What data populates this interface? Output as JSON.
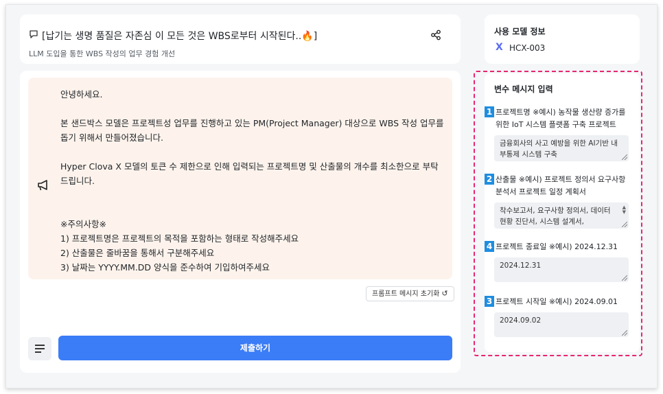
{
  "header": {
    "title": "[납기는 생명 품질은 자존심 이 모든 것은 WBS로부터 시작된다..🔥]",
    "subtitle": "LLM 도입을 통한 WBS 작성의 업무 경험 개선",
    "share_icon": "share-icon",
    "title_icon": "chat-bubble-icon"
  },
  "chat": {
    "megaphone_icon": "megaphone-icon",
    "lines": {
      "greeting": "안녕하세요.",
      "p1": "본 샌드박스 모델은 프로젝트성 업무를 진행하고 있는 PM(Project Manager) 대상으로 WBS 작성 업무를 돕기 위해서 만들어졌습니다.",
      "p2": "Hyper Clova X 모델의 토큰 수 제한으로 인해 입력되는 프로젝트명 및 산출물의 개수를 최소한으로 부탁드립니다.",
      "notice_title": "※주의사항※",
      "n1": "1) 프로젝트명은 프로젝트의 목적을 포함하는 형태로 작성해주세요",
      "n2": "2) 산출물은 줄바꿈을 통해서 구분해주세요",
      "n3": "3) 날짜는 YYYY.MM.DD 양식을 준수하여 기입하여주세요"
    },
    "reset_label": "프롬프트 메시지 초기화",
    "reset_icon": "refresh-icon",
    "menu_icon": "text-align-icon",
    "submit_label": "제출하기"
  },
  "model": {
    "title": "사용 모델 정보",
    "icon": "x-icon",
    "icon_glyph": "X",
    "name": "HCX-003",
    "accent": "#5a6cf0"
  },
  "variables": {
    "title": "변수 메시지 입력",
    "items": [
      {
        "num": "1",
        "label": "프로젝트명 ※예시) 농작물 생산량 증가를 위한 IoT 시스템 플랫폼 구축 프로젝트",
        "value": "금융회사의 사고 예방을 위한 AI기반 내부통제 시스템 구축"
      },
      {
        "num": "2",
        "label": "산출물 ※예시) 프로젝트 정의서 요구사항 분석서 프로젝트 일정 계획서",
        "value": "착수보고서, 요구사항 정의서, 데이터 현황 진단서, 시스템 설계서,"
      },
      {
        "num": "4",
        "label": "프로젝트 종료일 ※예시) 2024.12.31",
        "value": "2024.12.31"
      },
      {
        "num": "3",
        "label": "프로젝트 시작일 ※예시) 2024.09.01",
        "value": "2024.09.02"
      }
    ],
    "highlight_color": "#e8246f",
    "badge_color": "#1f8de0"
  },
  "colors": {
    "submit": "#3b7cf7",
    "bubble": "#fdf3ec"
  }
}
